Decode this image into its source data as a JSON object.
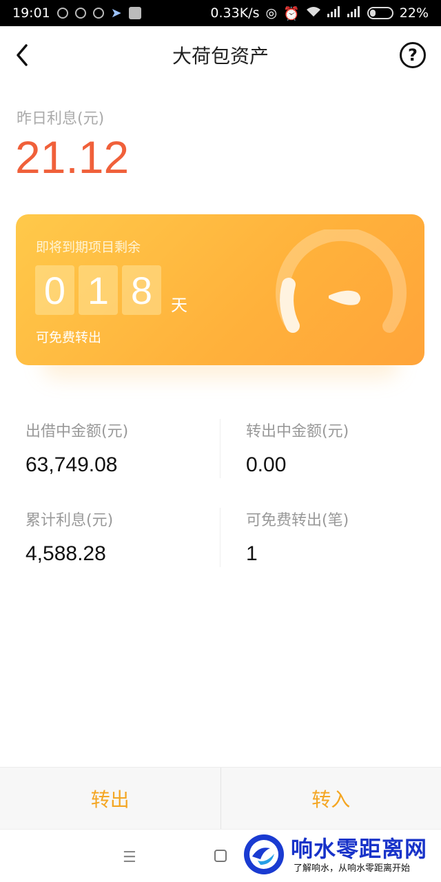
{
  "status_bar": {
    "time": "19:01",
    "network_speed": "0.33K/s",
    "battery": "22%"
  },
  "header": {
    "title": "大荷包资产",
    "help_label": "?"
  },
  "yesterday": {
    "label": "昨日利息(元)",
    "value": "21.12"
  },
  "card": {
    "label": "即将到期项目剩余",
    "digits": [
      "0",
      "1",
      "8"
    ],
    "unit": "天",
    "sub_label": "可免费转出",
    "colors": {
      "gradient_start": "#ffc94a",
      "gradient_end": "#ffa43a"
    }
  },
  "stats": {
    "lending_label": "出借中金额(元)",
    "lending_value": "63,749.08",
    "transferring_label": "转出中金额(元)",
    "transferring_value": "0.00",
    "cumulative_label": "累计利息(元)",
    "cumulative_value": "4,588.28",
    "free_label": "可免费转出(笔)",
    "free_value": "1"
  },
  "actions": {
    "transfer_out": "转出",
    "transfer_in": "转入",
    "accent": "#f4a623"
  },
  "nav": {
    "menu_glyph": "☰"
  },
  "watermark": {
    "title": "响水零距离网",
    "subtitle": "了解响水，从响水零距离开始"
  },
  "colors": {
    "interest_red": "#f0603a"
  }
}
